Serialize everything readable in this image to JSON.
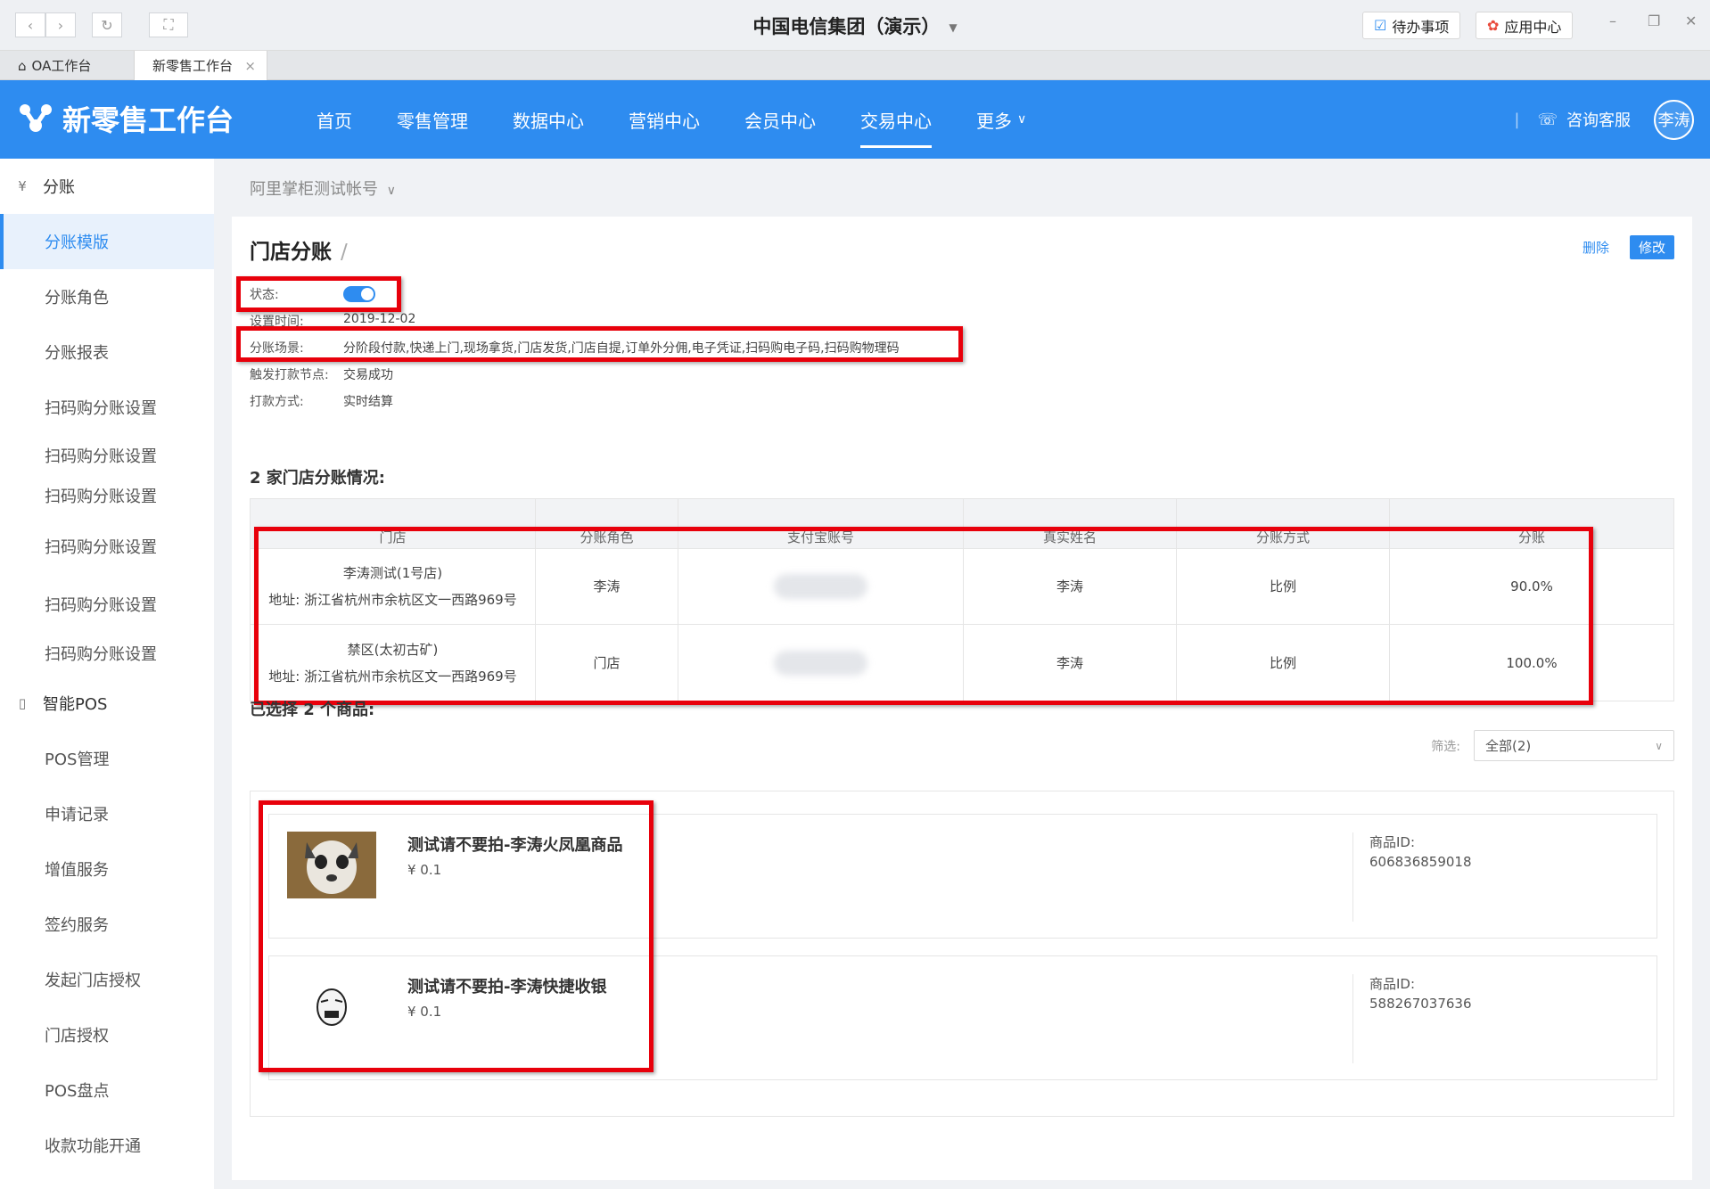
{
  "window": {
    "title": "中国电信集团（演示）",
    "todo_label": "待办事项",
    "app_center_label": "应用中心"
  },
  "tabs": [
    {
      "label": "OA工作台"
    },
    {
      "label": "新零售工作台"
    }
  ],
  "header": {
    "brand": "新零售工作台",
    "menu": [
      "首页",
      "零售管理",
      "数据中心",
      "营销中心",
      "会员中心",
      "交易中心",
      "更多"
    ],
    "active_menu": "交易中心",
    "support_label": "咨询客服",
    "user_name": "李涛"
  },
  "sidebar": {
    "group1": "分账",
    "items1": [
      "分账模版",
      "分账角色",
      "分账报表",
      "扫码购分账设置",
      "扫码购分账设置",
      "扫码购分账设置",
      "扫码购分账设置",
      "扫码购分账设置",
      "扫码购分账设置"
    ],
    "group2": "智能POS",
    "items2": [
      "POS管理",
      "申请记录",
      "增值服务",
      "签约服务",
      "发起门店授权",
      "门店授权",
      "POS盘点",
      "收款功能开通"
    ]
  },
  "account_selector": "阿里掌柜测试帐号",
  "page": {
    "title": "门店分账",
    "separator": "/",
    "delete_label": "删除",
    "edit_label": "修改",
    "info": {
      "status_label": "状态:",
      "status_on": true,
      "set_time_label": "设置时间:",
      "set_time": "2019-12-02",
      "scene_label": "分账场景:",
      "scene": "分阶段付款,快递上门,现场拿货,门店发货,门店自提,订单外分佣,电子凭证,扫码购电子码,扫码购物理码",
      "trigger_label": "触发打款节点:",
      "trigger": "交易成功",
      "pay_method_label": "打款方式:",
      "pay_method": "实时结算"
    },
    "stores_title": "2 家门店分账情况:",
    "table": {
      "headers": [
        "门店",
        "分账角色",
        "支付宝账号",
        "真实姓名",
        "分账方式",
        "分账"
      ],
      "rows": [
        {
          "store": "李涛测试(1号店)",
          "address": "地址: 浙江省杭州市余杭区文一西路969号",
          "role": "李涛",
          "alipay": "",
          "name": "李涛",
          "mode": "比例",
          "share": "90.0%"
        },
        {
          "store": "禁区(太初古矿)",
          "address": "地址: 浙江省杭州市余杭区文一西路969号",
          "role": "门店",
          "alipay": "",
          "name": "李涛",
          "mode": "比例",
          "share": "100.0%"
        }
      ]
    },
    "products_title": "已选择 2 个商品:",
    "filter_label": "筛选:",
    "filter_value": "全部(2)",
    "products": [
      {
        "name": "测试请不要拍-李涛火凤凰商品",
        "price": "¥ 0.1",
        "id_label": "商品ID:",
        "id": "606836859018"
      },
      {
        "name": "测试请不要拍-李涛快捷收银",
        "price": "¥ 0.1",
        "id_label": "商品ID:",
        "id": "588267037636"
      }
    ]
  },
  "colors": {
    "accent": "#2e8cf0",
    "highlight": "#e8000b"
  }
}
